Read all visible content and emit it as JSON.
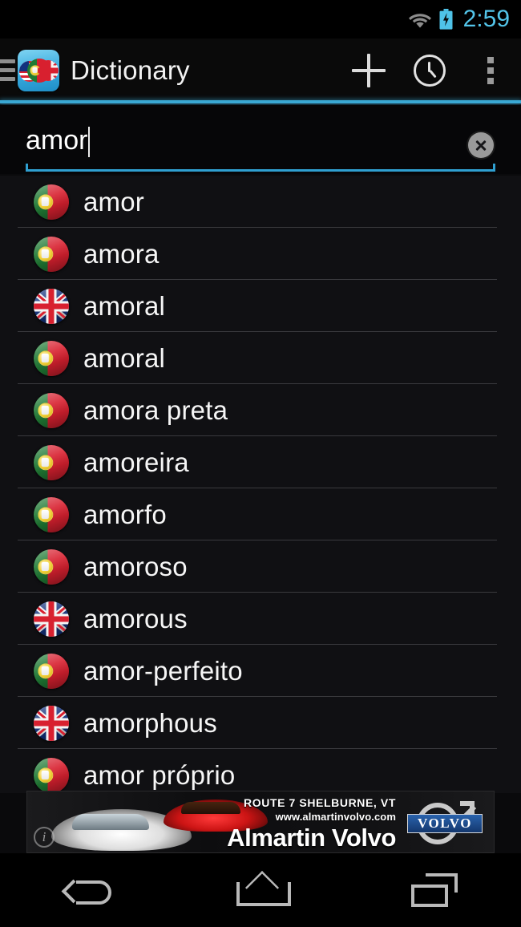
{
  "status_bar": {
    "time": "2:59",
    "wifi_icon": "wifi-icon",
    "battery_icon": "battery-charging-icon",
    "accent_color": "#53c5ea"
  },
  "action_bar": {
    "drawer_icon": "hamburger-menu-icon",
    "app_icon": "dictionary-app-icon",
    "title": "Dictionary",
    "actions": [
      {
        "name": "add-button",
        "icon": "plus-icon"
      },
      {
        "name": "history-button",
        "icon": "clock-icon"
      },
      {
        "name": "overflow-button",
        "icon": "more-vertical-icon"
      }
    ],
    "underline_color": "#3aa8d4"
  },
  "search": {
    "value": "amor",
    "placeholder": "",
    "clear_icon": "clear-circle-icon",
    "underline_color": "#2f9fd0"
  },
  "results": [
    {
      "lang": "pt",
      "label": "amor"
    },
    {
      "lang": "pt",
      "label": "amora"
    },
    {
      "lang": "uk",
      "label": "amoral"
    },
    {
      "lang": "pt",
      "label": "amoral"
    },
    {
      "lang": "pt",
      "label": "amora preta"
    },
    {
      "lang": "pt",
      "label": "amoreira"
    },
    {
      "lang": "pt",
      "label": "amorfo"
    },
    {
      "lang": "pt",
      "label": "amoroso"
    },
    {
      "lang": "uk",
      "label": "amorous"
    },
    {
      "lang": "pt",
      "label": "amor-perfeito"
    },
    {
      "lang": "uk",
      "label": "amorphous"
    },
    {
      "lang": "pt",
      "label": "amor próprio"
    }
  ],
  "ad": {
    "line1": "ROUTE 7   SHELBURNE, VT",
    "line2": "www.almartinvolvo.com",
    "brand": "Almartin Volvo",
    "logo_text": "VOLVO",
    "info_icon": "ad-info-icon",
    "info_glyph": "i"
  },
  "nav_bar": {
    "buttons": [
      {
        "name": "back-button",
        "icon": "back-arrow-icon"
      },
      {
        "name": "home-button",
        "icon": "home-icon"
      },
      {
        "name": "recents-button",
        "icon": "recents-icon"
      }
    ]
  }
}
